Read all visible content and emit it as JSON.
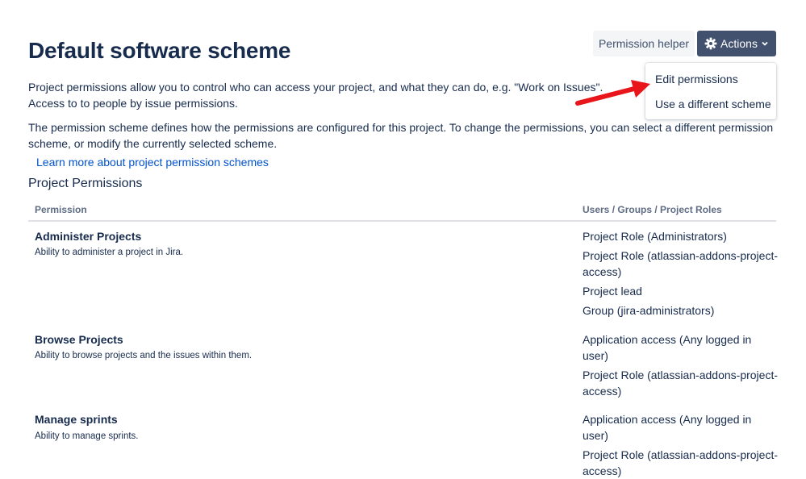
{
  "header": {
    "title": "Default software scheme",
    "permission_helper_label": "Permission helper",
    "actions_label": "Actions"
  },
  "actions_menu": {
    "items": [
      {
        "label": "Edit permissions"
      },
      {
        "label": "Use a different scheme"
      }
    ]
  },
  "intro": {
    "paragraph1": "Project permissions allow you to control who can access your project, and what they can do, e.g. \"Work on Issues\". Access to to people by issue permissions.",
    "paragraph2": "The permission scheme defines how the permissions are configured for this project. To change the permissions, you can select a different permission scheme, or modify the currently selected scheme.",
    "learn_more_link": "Learn more about project permission schemes"
  },
  "permissions": {
    "section_title": "Project Permissions",
    "columns": [
      "Permission",
      "Users / Groups / Project Roles"
    ],
    "rows": [
      {
        "name": "Administer Projects",
        "description": "Ability to administer a project in Jira.",
        "grants": [
          "Project Role (Administrators)",
          "Project Role (atlassian-addons-project-access)",
          "Project lead",
          "Group (jira-administrators)"
        ]
      },
      {
        "name": "Browse Projects",
        "description": "Ability to browse projects and the issues within them.",
        "grants": [
          "Application access (Any logged in user)",
          "Project Role (atlassian-addons-project-access)"
        ]
      },
      {
        "name": "Manage sprints",
        "description": "Ability to manage sprints.",
        "grants": [
          "Application access (Any logged in user)",
          "Project Role (atlassian-addons-project-access)"
        ]
      }
    ]
  },
  "colors": {
    "actions_button_bg": "#42526e",
    "link": "#0052cc",
    "text": "#172b4d",
    "annotation_arrow": "#e8161b"
  }
}
